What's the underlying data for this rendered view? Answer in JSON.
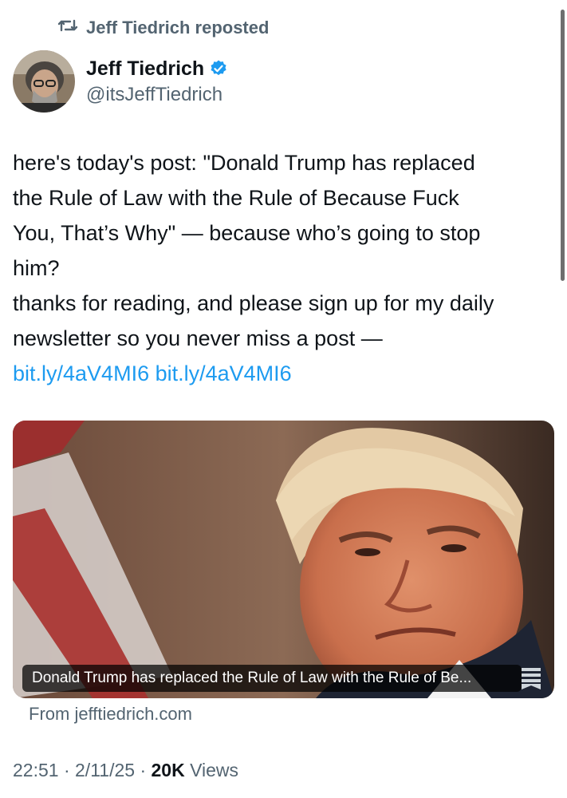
{
  "repost": {
    "label": "Jeff Tiedrich reposted"
  },
  "author": {
    "display_name": "Jeff Tiedrich",
    "handle": "@itsJeffTiedrich",
    "verified": true
  },
  "post": {
    "lines": [
      "here's today's post: \"Donald Trump has replaced",
      "the Rule of Law with the Rule of Because Fuck",
      "You, That’s Why\" — because who’s going to stop",
      "him?",
      "thanks for reading, and please sign up for my daily",
      "newsletter so you never miss a post —"
    ],
    "links": [
      "bit.ly/4aV4MI6",
      "bit.ly/4aV4MI6"
    ]
  },
  "card": {
    "caption": "Donald Trump has replaced the Rule of Law with the Rule of Be...",
    "source": "From jefftiedrich.com"
  },
  "meta": {
    "time": "22:51",
    "date": "2/11/25",
    "views_count": "20K",
    "views_label": "Views"
  },
  "colors": {
    "link": "#1d9bf0",
    "secondary": "#536471",
    "verified": "#1d9bf0"
  },
  "icons": {
    "repost": "repost-icon",
    "verified": "verified-badge-icon",
    "bookmark": "bookmark-icon"
  }
}
